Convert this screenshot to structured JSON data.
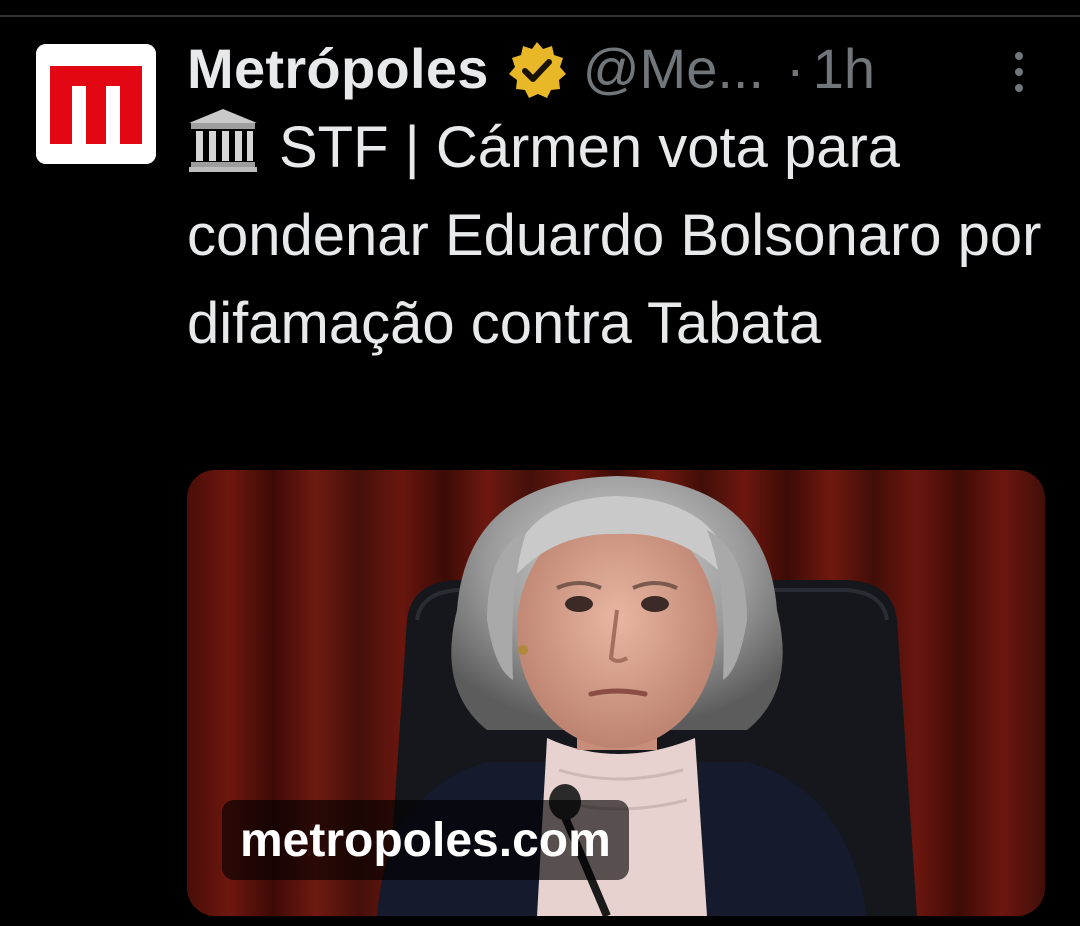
{
  "tweet": {
    "author_name": "Metrópoles",
    "handle": "@Me...",
    "separator": "·",
    "time": "1h",
    "text": "STF | Cármen vota para condenar Eduardo Bolsonaro por difamação contra Tabata",
    "leading_emoji_icon": "classical-building-icon",
    "verified_icon": "gold-verified-badge-icon",
    "more_icon": "vertical-ellipsis-icon"
  },
  "media": {
    "domain_label": "metropoles.com"
  },
  "colors": {
    "background": "#000000",
    "text_primary": "#e7e9ea",
    "text_secondary": "#71767b",
    "brand_red": "#e30613",
    "verified_gold": "#e8b829"
  }
}
